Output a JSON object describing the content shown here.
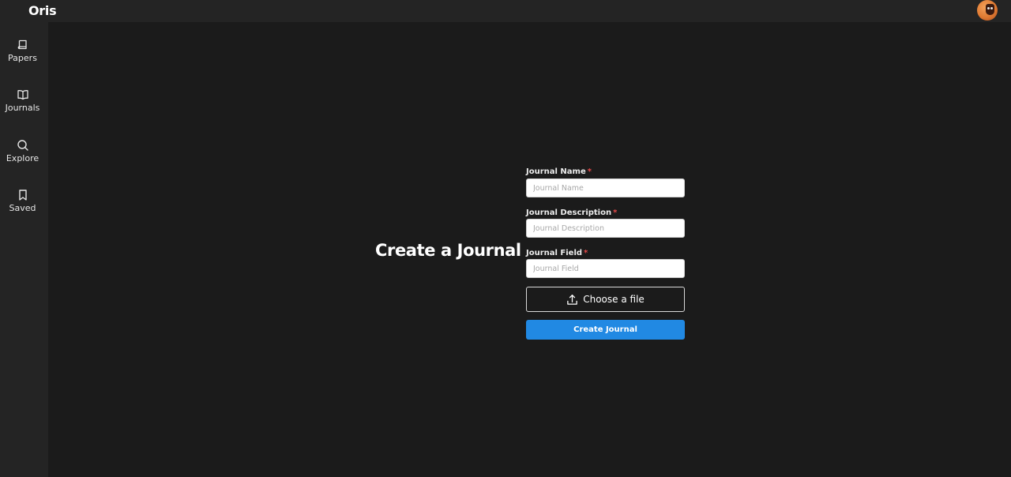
{
  "app": {
    "brand": "Oris",
    "accent_color": "#2189e3"
  },
  "sidebar": {
    "items": [
      {
        "label": "Papers",
        "icon": "book-icon"
      },
      {
        "label": "Journals",
        "icon": "open-book-icon"
      },
      {
        "label": "Explore",
        "icon": "search-icon"
      },
      {
        "label": "Saved",
        "icon": "bookmark-icon"
      }
    ]
  },
  "form": {
    "heading": "Create a Journal",
    "required_marker": "*",
    "fields": [
      {
        "label": "Journal Name",
        "placeholder": "Journal Name",
        "value": ""
      },
      {
        "label": "Journal Description",
        "placeholder": "Journal Description",
        "value": ""
      },
      {
        "label": "Journal Field",
        "placeholder": "Journal Field",
        "value": ""
      }
    ],
    "file_button_label": "Choose a file",
    "file_icon": "upload-icon",
    "submit_label": "Create Journal"
  }
}
